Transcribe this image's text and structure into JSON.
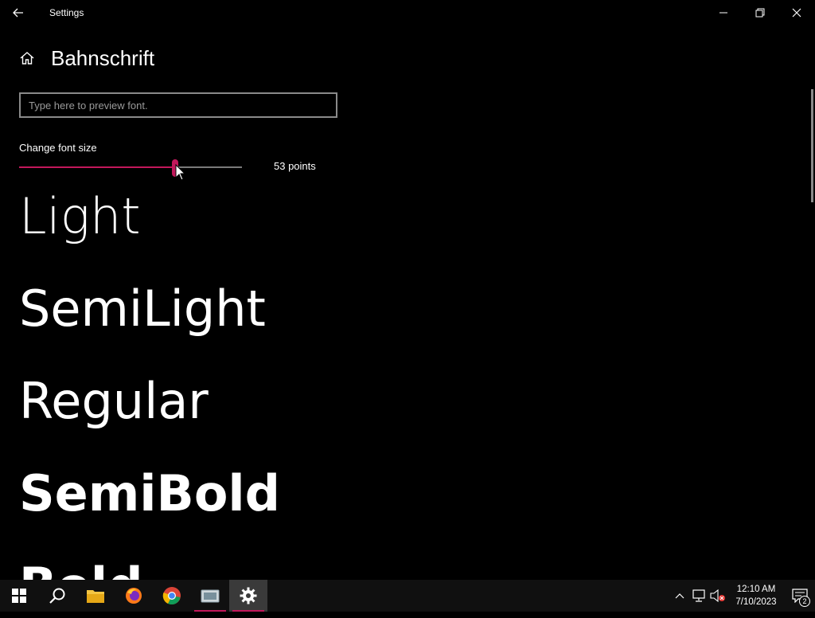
{
  "window": {
    "title": "Settings"
  },
  "header": {
    "page_title": "Bahnschrift"
  },
  "preview": {
    "placeholder": "Type here to preview font.",
    "value": ""
  },
  "font_size": {
    "label": "Change font size",
    "value_text": "53 points",
    "slider_fraction": 0.7
  },
  "samples": [
    "Light",
    "SemiLight",
    "Regular",
    "SemiBold",
    "Bold"
  ],
  "taskbar": {
    "apps": [
      "start-icon",
      "search-icon",
      "file-explorer-icon",
      "firefox-icon",
      "chrome-icon",
      "app-icon",
      "settings-icon"
    ],
    "clock_time": "12:10 AM",
    "clock_date": "7/10/2023",
    "notification_count": "2"
  },
  "colors": {
    "accent": "#c2185b",
    "background": "#000000",
    "taskbar": "#101010"
  }
}
